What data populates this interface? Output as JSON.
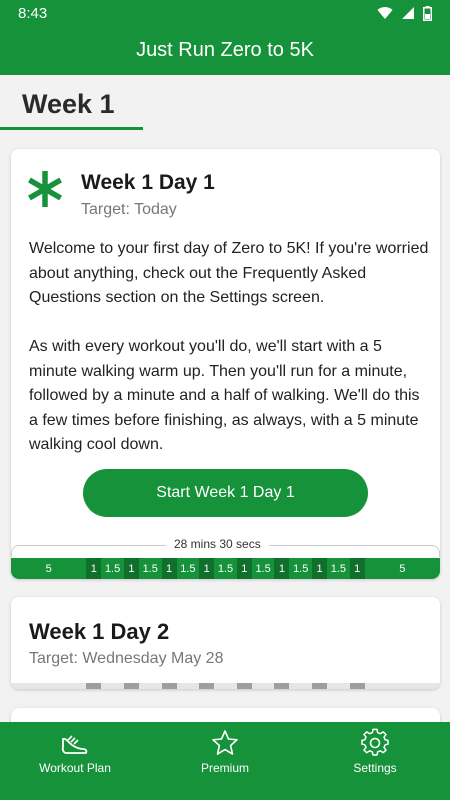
{
  "status_bar": {
    "time": "8:43",
    "icons": [
      "wifi-icon",
      "signal-icon",
      "battery-icon"
    ]
  },
  "app_bar": {
    "title": "Just Run Zero to 5K"
  },
  "week_header": {
    "title": "Week 1"
  },
  "colors": {
    "primary": "#16923a",
    "primary_dark": "#0f6f2b",
    "text_secondary": "#777777"
  },
  "current_workout": {
    "title": "Week 1 Day 1",
    "target": "Target: Today",
    "icon": "asterisk-icon",
    "description_1": "Welcome to your first day of Zero to 5K! If you're worried about anything, check out the Frequently Asked Questions section on the Settings screen.",
    "description_2": "As with every workout you'll do, we'll start with a 5 minute walking warm up. Then you'll run for a minute, followed by a minute and a half of walking. We'll do this a few times before finishing, as always, with a 5 minute walking cool down.",
    "start_button": "Start Week 1 Day 1",
    "total_duration": "28 mins 30 secs",
    "segments": [
      {
        "label": "5",
        "kind": "walk"
      },
      {
        "label": "1",
        "kind": "run"
      },
      {
        "label": "1.5",
        "kind": "walk"
      },
      {
        "label": "1",
        "kind": "run"
      },
      {
        "label": "1.5",
        "kind": "walk"
      },
      {
        "label": "1",
        "kind": "run"
      },
      {
        "label": "1.5",
        "kind": "walk"
      },
      {
        "label": "1",
        "kind": "run"
      },
      {
        "label": "1.5",
        "kind": "walk"
      },
      {
        "label": "1",
        "kind": "run"
      },
      {
        "label": "1.5",
        "kind": "walk"
      },
      {
        "label": "1",
        "kind": "run"
      },
      {
        "label": "1.5",
        "kind": "walk"
      },
      {
        "label": "1",
        "kind": "run"
      },
      {
        "label": "1.5",
        "kind": "walk"
      },
      {
        "label": "1",
        "kind": "run"
      },
      {
        "label": "5",
        "kind": "walk"
      }
    ]
  },
  "next_workout": {
    "title": "Week 1 Day 2",
    "target": "Target: Wednesday May 28"
  },
  "bottom_nav": {
    "items": [
      {
        "label": "Workout Plan",
        "icon": "running-shoe-icon"
      },
      {
        "label": "Premium",
        "icon": "star-icon"
      },
      {
        "label": "Settings",
        "icon": "gear-icon"
      }
    ]
  }
}
